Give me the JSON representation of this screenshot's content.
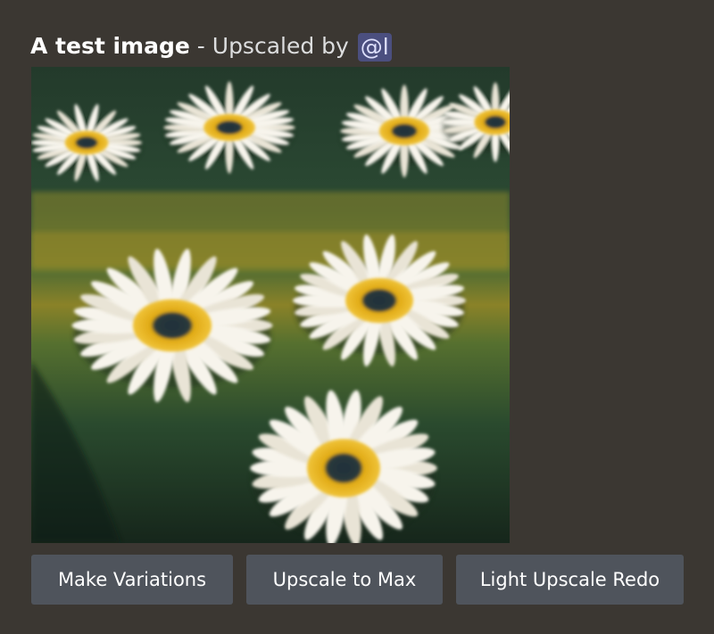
{
  "message": {
    "title": "A test image",
    "separator": " - ",
    "upscaled_text": "Upscaled by ",
    "mention": "@l"
  },
  "image": {
    "icon": "daisy-field-image"
  },
  "buttons": {
    "make_variations": "Make Variations",
    "upscale_to_max": "Upscale to Max",
    "light_upscale_redo": "Light Upscale Redo"
  },
  "colors": {
    "background": "#3b3732",
    "button": "#4f545c",
    "mention_bg": "#4b4f7f",
    "petal": "#f4f1e8",
    "center": "#e0a914",
    "grass_dark": "#1d3324",
    "field_gold": "#8a8228"
  }
}
